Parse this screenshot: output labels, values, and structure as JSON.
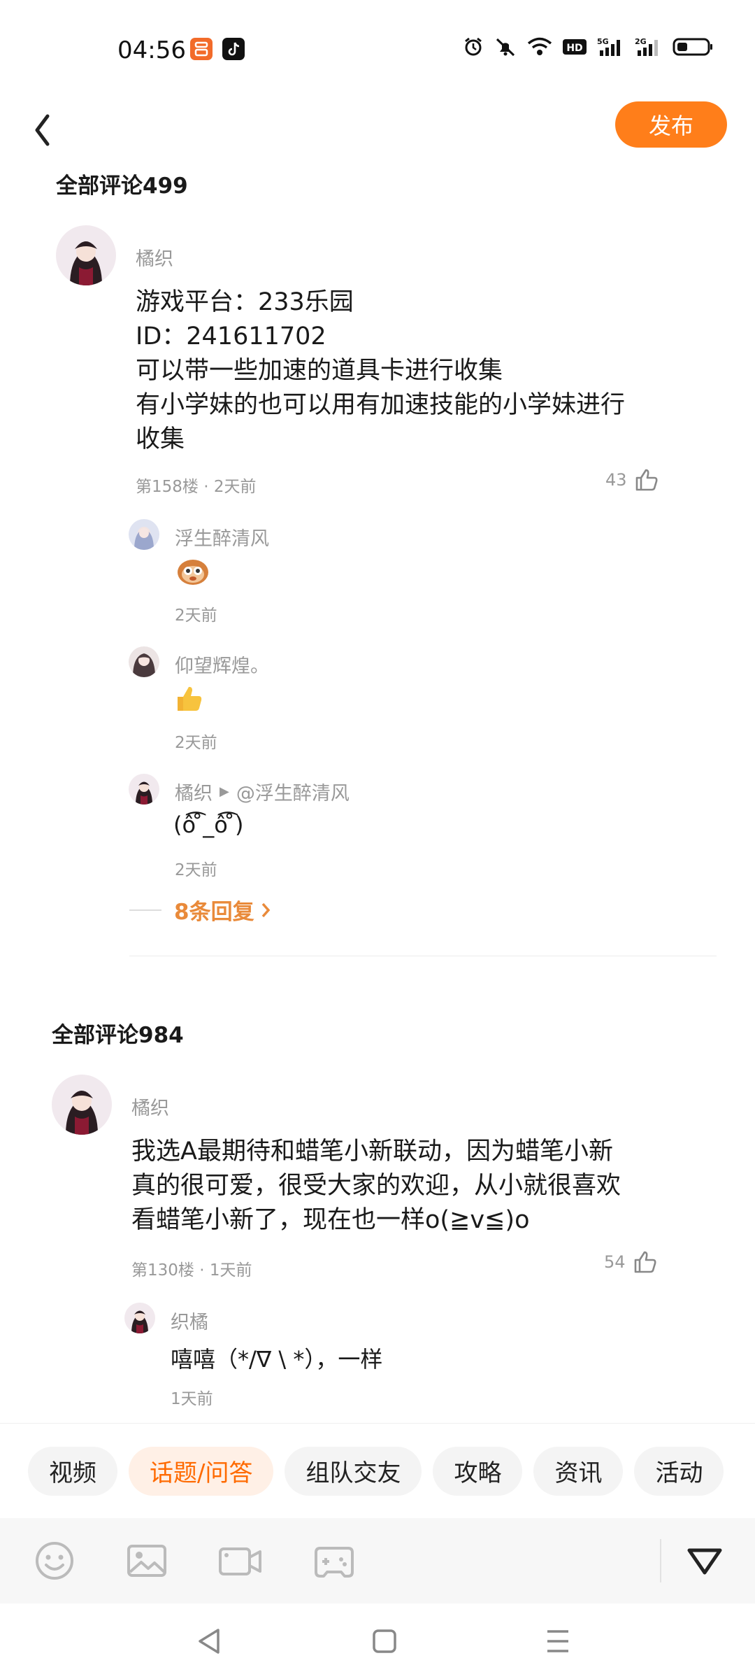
{
  "status": {
    "time": "04:56"
  },
  "header": {
    "publish_label": "发布"
  },
  "sections": [
    {
      "title": "全部评论499"
    },
    {
      "title": "全部评论984"
    }
  ],
  "comments": [
    {
      "user": "橘织",
      "lines": [
        "游戏平台：233乐园",
        "ID：241611702",
        "可以带一些加速的道具卡进行收集",
        "有小学妹的也可以用有加速技能的小学妹进行",
        "收集"
      ],
      "meta": "第158楼 · 2天前",
      "likes": "43",
      "replies": [
        {
          "user": "浮生醉清风",
          "text": "",
          "time": "2天前"
        },
        {
          "user": "仰望辉煌。",
          "text": "",
          "time": "2天前"
        },
        {
          "user": "橘织",
          "target": "@浮生醉清风",
          "text": "(ô͡ ̊_ô͡ ̊)",
          "time": "2天前"
        }
      ],
      "more_replies": "8条回复"
    },
    {
      "user": "橘织",
      "lines": [
        "我选A最期待和蜡笔小新联动，因为蜡笔小新",
        "真的很可爱，很受大家的欢迎，从小就很喜欢",
        "看蜡笔小新了，现在也一样o(≧v≦)o"
      ],
      "meta": "第130楼 · 1天前",
      "likes": "54",
      "replies": [
        {
          "user": "织橘",
          "text": "嘻嘻（*/∇ \\ *），一样",
          "time": "1天前"
        }
      ]
    }
  ],
  "tabs": [
    {
      "label": "视频",
      "active": false
    },
    {
      "label": "话题/问答",
      "active": true
    },
    {
      "label": "组队交友",
      "active": false
    },
    {
      "label": "攻略",
      "active": false
    },
    {
      "label": "资讯",
      "active": false
    },
    {
      "label": "活动",
      "active": false
    }
  ],
  "colors": {
    "accent": "#ff7e1a",
    "active_tab_text": "#ff6a00",
    "more_replies": "#e98a3a"
  },
  "icons": [
    "back-arrow-icon",
    "emoji-icon",
    "image-icon",
    "video-icon",
    "gamepad-icon",
    "collapse-triangle-icon",
    "like-icon"
  ]
}
